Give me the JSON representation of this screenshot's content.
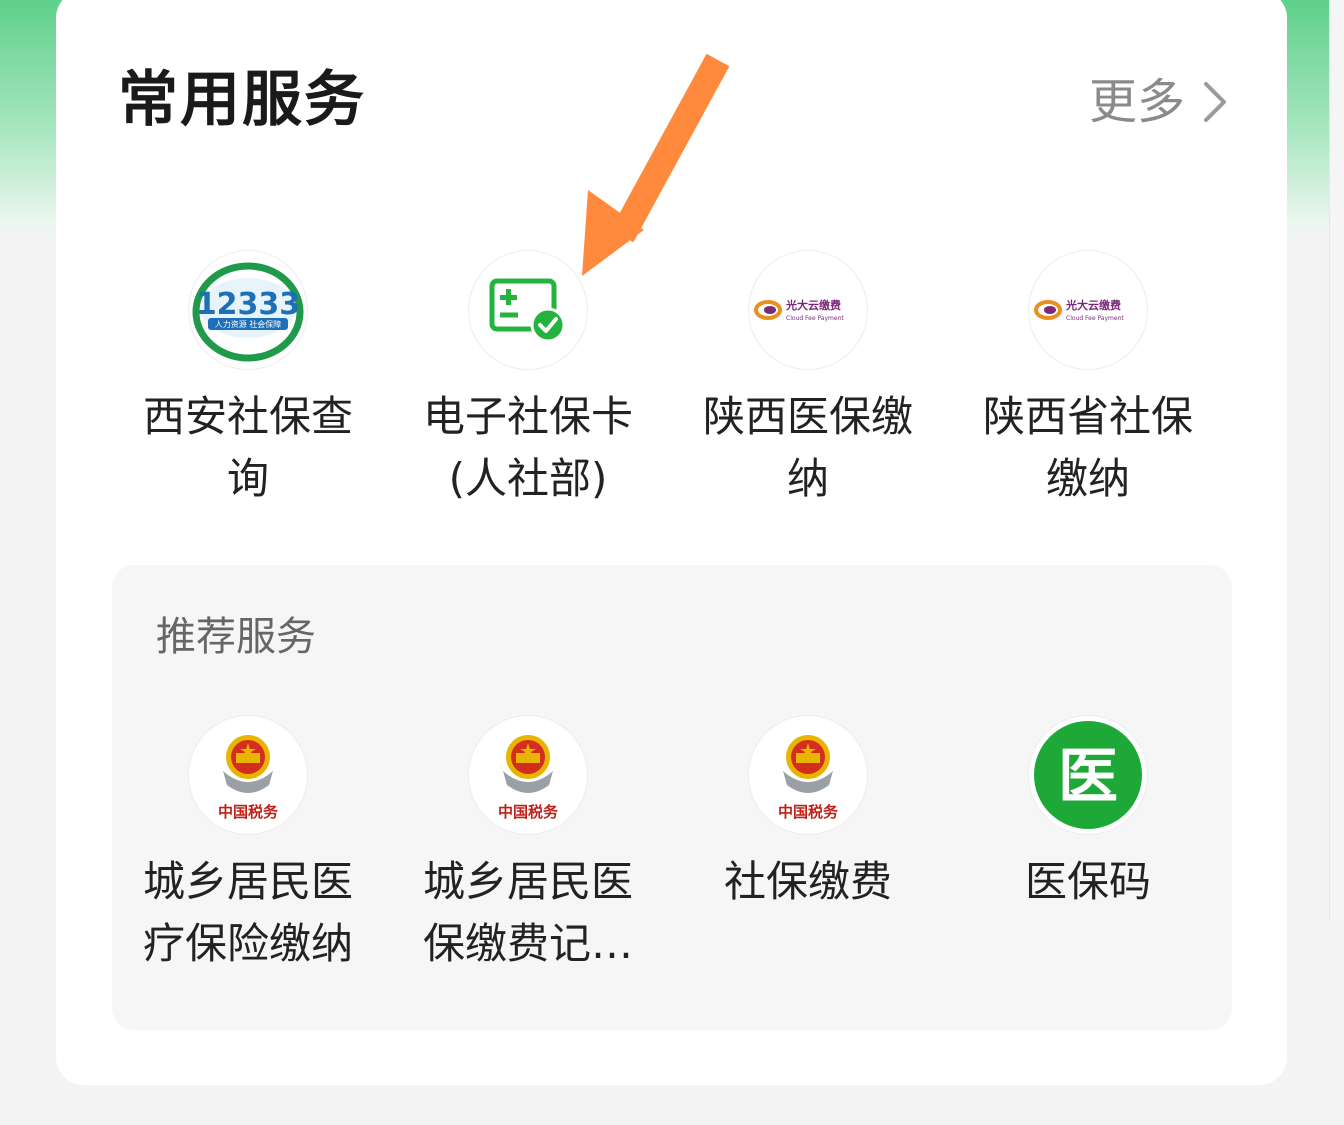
{
  "common": {
    "title": "常用服务",
    "more_label": "更多"
  },
  "top_services": [
    {
      "label": "西安社保查询",
      "icon": "12333-hrss-logo",
      "icon_text": "12333",
      "icon_sub": "人力资源 社会保障"
    },
    {
      "label": "电子社保卡(人社部)",
      "icon": "medical-card-check-icon"
    },
    {
      "label": "陕西医保缴纳",
      "icon": "cloud-fee-payment-logo",
      "icon_text": "光大云缴费",
      "icon_sub": "Cloud Fee Payment"
    },
    {
      "label": "陕西省社保缴纳",
      "icon": "cloud-fee-payment-logo",
      "icon_text": "光大云缴费",
      "icon_sub": "Cloud Fee Payment"
    }
  ],
  "recommended": {
    "title": "推荐服务",
    "services": [
      {
        "label": "城乡居民医疗保险缴纳",
        "icon": "china-tax-emblem",
        "icon_text": "中国税务"
      },
      {
        "label": "城乡居民医保缴费记…",
        "icon": "china-tax-emblem",
        "icon_text": "中国税务"
      },
      {
        "label": "社保缴费",
        "icon": "china-tax-emblem",
        "icon_text": "中国税务"
      },
      {
        "label": "医保码",
        "icon": "medical-insurance-code-icon",
        "icon_text": "医"
      }
    ]
  },
  "colors": {
    "header_green": "#5fd08a",
    "arrow_orange": "#ff8a3d",
    "card_green": "#1ea838",
    "emblem_red": "#d22d1f",
    "emblem_gold": "#e8b400",
    "cloud_purple": "#7a2a7a"
  }
}
